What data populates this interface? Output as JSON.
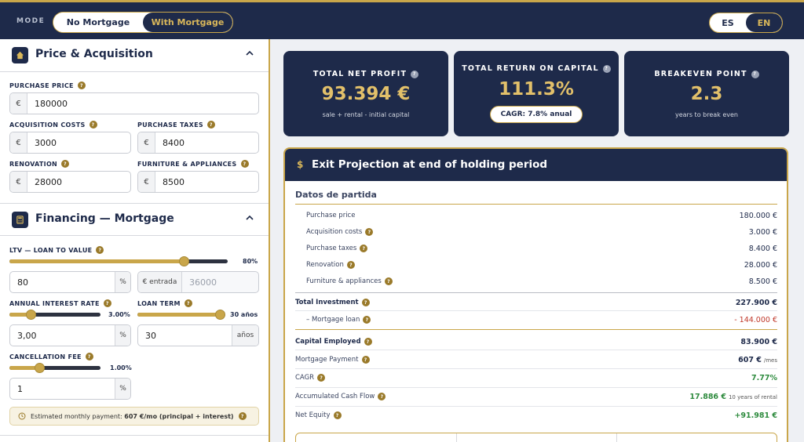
{
  "topbar": {
    "mode_label": "MODE",
    "mode_options": [
      "No Mortgage",
      "With Mortgage"
    ],
    "lang_options": [
      "ES",
      "EN"
    ]
  },
  "price": {
    "title": "Price & Acquisition",
    "purchase_price": {
      "label": "PURCHASE PRICE",
      "prefix": "€",
      "value": "180000"
    },
    "acq_costs": {
      "label": "ACQUISITION COSTS",
      "prefix": "€",
      "value": "3000"
    },
    "purchase_taxes": {
      "label": "PURCHASE TAXES",
      "prefix": "€",
      "value": "8400"
    },
    "renovation": {
      "label": "RENOVATION",
      "prefix": "€",
      "value": "28000"
    },
    "furniture": {
      "label": "FURNITURE & APPLIANCES",
      "prefix": "€",
      "value": "8500"
    }
  },
  "financing": {
    "title": "Financing — Mortgage",
    "ltv": {
      "label": "LTV — LOAN TO VALUE",
      "value_text": "80%",
      "level": 0.8,
      "input": "80",
      "suffix": "%",
      "entrada_prefix": "€ entrada",
      "entrada_value": "36000"
    },
    "interest": {
      "label": "ANNUAL INTEREST RATE",
      "value_text": "3.00%",
      "level": 0.23,
      "input": "3,00",
      "suffix": "%"
    },
    "term": {
      "label": "LOAN TERM",
      "value_text": "30 años",
      "level": 1.0,
      "input": "30",
      "suffix": "años"
    },
    "cancel": {
      "label": "CANCELLATION FEE",
      "value_text": "1.00%",
      "level": 0.33,
      "input": "1",
      "suffix": "%"
    },
    "monthly_prefix": "Estimated monthly payment: ",
    "monthly_value": "607 €/mo (principal + interest)"
  },
  "kpis": {
    "net_profit": {
      "title": "TOTAL NET PROFIT",
      "value": "93.394 €",
      "sub": "sale + rental - initial capital"
    },
    "roc": {
      "title": "TOTAL RETURN ON CAPITAL",
      "value": "111.3%",
      "pill": "CAGR: 7.8% anual"
    },
    "breakeven": {
      "title": "BREAKEVEN POINT",
      "value": "2.3",
      "sub": "years to break even"
    }
  },
  "projection": {
    "title": "Exit Projection at end of holding period",
    "datos_title": "Datos de partida",
    "rows": {
      "purchase_price": {
        "label": "Purchase price",
        "value": "180.000 €"
      },
      "acq_costs": {
        "label": "Acquisition costs",
        "value": "3.000 €"
      },
      "purchase_taxes": {
        "label": "Purchase taxes",
        "value": "8.400 €"
      },
      "renovation": {
        "label": "Renovation",
        "value": "28.000 €"
      },
      "furniture": {
        "label": "Furniture & appliances",
        "value": "8.500 €"
      },
      "total_investment": {
        "label": "Total Investment",
        "value": "227.900 €"
      },
      "mortgage_loan": {
        "label": "– Mortgage loan",
        "value": "- 144.000 €"
      },
      "capital_employed": {
        "label": "Capital Employed",
        "value": "83.900 €"
      },
      "mortgage_payment": {
        "label": "Mortgage Payment",
        "value": "607 €",
        "unit": "/mes"
      },
      "cagr": {
        "label": "CAGR",
        "value": "7.77%"
      },
      "cash_flow": {
        "label": "Accumulated Cash Flow",
        "value": "17.886 €",
        "unit": "10 years of rental"
      },
      "net_equity": {
        "label": "Net Equity",
        "value": "+91.981 €"
      }
    }
  }
}
